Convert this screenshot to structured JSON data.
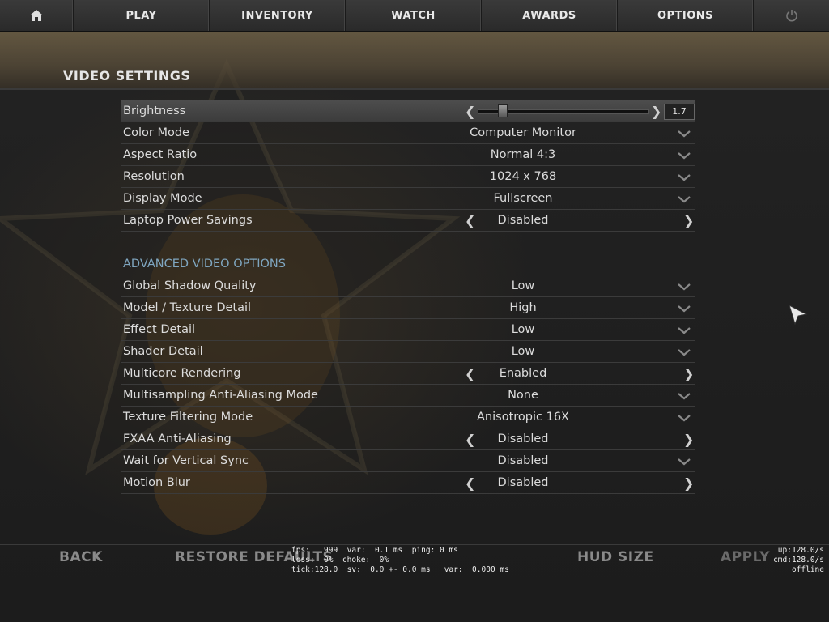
{
  "nav": {
    "home_icon": "home-icon",
    "items": [
      "PLAY",
      "INVENTORY",
      "WATCH",
      "AWARDS",
      "OPTIONS"
    ],
    "power_icon": "power-icon"
  },
  "page": {
    "title": "VIDEO SETTINGS"
  },
  "brightness": {
    "label": "Brightness",
    "value": "1.7",
    "slider_level": 0.12
  },
  "basic_settings": [
    {
      "label": "Color Mode",
      "value": "Computer Monitor",
      "control": "dropdown"
    },
    {
      "label": "Aspect Ratio",
      "value": "Normal 4:3",
      "control": "dropdown"
    },
    {
      "label": "Resolution",
      "value": "1024 x 768",
      "control": "dropdown"
    },
    {
      "label": "Display Mode",
      "value": "Fullscreen",
      "control": "dropdown"
    },
    {
      "label": "Laptop Power Savings",
      "value": "Disabled",
      "control": "toggle"
    }
  ],
  "advanced": {
    "title": "ADVANCED VIDEO OPTIONS",
    "settings": [
      {
        "label": "Global Shadow Quality",
        "value": "Low",
        "control": "dropdown"
      },
      {
        "label": "Model / Texture Detail",
        "value": "High",
        "control": "dropdown"
      },
      {
        "label": "Effect Detail",
        "value": "Low",
        "control": "dropdown"
      },
      {
        "label": "Shader Detail",
        "value": "Low",
        "control": "dropdown"
      },
      {
        "label": "Multicore Rendering",
        "value": "Enabled",
        "control": "toggle"
      },
      {
        "label": "Multisampling Anti-Aliasing Mode",
        "value": "None",
        "control": "dropdown"
      },
      {
        "label": "Texture Filtering Mode",
        "value": "Anisotropic 16X",
        "control": "dropdown"
      },
      {
        "label": "FXAA Anti-Aliasing",
        "value": "Disabled",
        "control": "toggle"
      },
      {
        "label": "Wait for Vertical Sync",
        "value": "Disabled",
        "control": "dropdown"
      },
      {
        "label": "Motion Blur",
        "value": "Disabled",
        "control": "toggle"
      }
    ]
  },
  "bottom": {
    "back": "BACK",
    "restore": "RESTORE DEFAULTS",
    "hud_size": "HUD SIZE",
    "apply": "APPLY"
  },
  "netgraph": {
    "line1": "fps:   999  var:  0.1 ms  ping: 0 ms",
    "line2": "loss:  0%  choke:  0%",
    "line3": "tick:128.0  sv:  0.0 +- 0.0 ms   var:  0.000 ms",
    "up": "up:128.0/s",
    "cmd": "cmd:128.0/s",
    "status": "offline"
  },
  "colors": {
    "section_title": "#7fa6c0",
    "text": "#dcdcdc",
    "bottom_buttons": "#8a8a8a"
  }
}
